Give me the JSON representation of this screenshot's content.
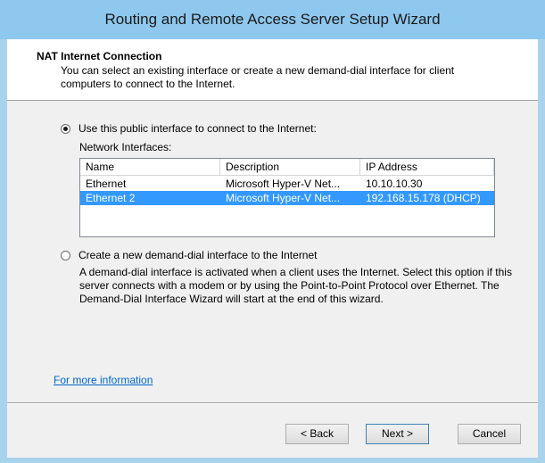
{
  "window": {
    "title": "Routing and Remote Access Server Setup Wizard"
  },
  "header": {
    "title": "NAT Internet Connection",
    "description": "You can select an existing interface or create a new demand-dial interface for client computers to connect to the Internet."
  },
  "option_public": {
    "label": "Use this public interface to connect to the Internet:",
    "selected": true
  },
  "network_interfaces": {
    "label": "Network Interfaces:",
    "columns": [
      "Name",
      "Description",
      "IP Address"
    ],
    "rows": [
      {
        "name": "Ethernet",
        "description": "Microsoft Hyper-V Net...",
        "ip": "10.10.10.30",
        "selected": false
      },
      {
        "name": "Ethernet 2",
        "description": "Microsoft Hyper-V Net...",
        "ip": "192.168.15.178 (DHCP)",
        "selected": true
      }
    ]
  },
  "option_demand_dial": {
    "label": "Create a new demand-dial interface to the Internet",
    "selected": false,
    "description": "A demand-dial interface is activated when a client uses the Internet. Select this option if this server connects with a modem or by using the Point-to-Point Protocol over Ethernet. The Demand-Dial Interface Wizard will start at the end of this wizard."
  },
  "more_info_link": "For more information",
  "buttons": {
    "back": "< Back",
    "next": "Next >",
    "cancel": "Cancel"
  }
}
